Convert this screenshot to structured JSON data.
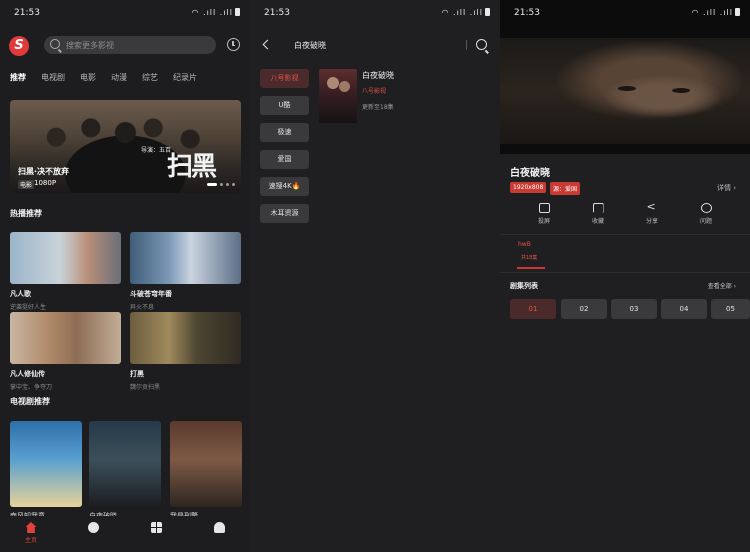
{
  "status": {
    "time": "21:53",
    "icons": "WiFi 5G 5G"
  },
  "home": {
    "logo": "S",
    "search_placeholder": "搜索更多影视",
    "categories": [
      "推荐",
      "电视剧",
      "电影",
      "动漫",
      "综艺",
      "纪录片"
    ],
    "banner": {
      "title": "扫黑·决不放弃",
      "badge": "电影",
      "resolution": "1080P",
      "director": "导演：五百",
      "big_title": "扫黑"
    },
    "hot_title": "热播推荐",
    "hot": [
      {
        "title": "凡人歌",
        "sub": "逆袭挺好人生"
      },
      {
        "title": "斗破苍穹年番",
        "sub": "异火不息"
      },
      {
        "title": "凡人修仙传",
        "sub": "掌中宝、争夺刀"
      },
      {
        "title": "打黑",
        "sub": "魏尔贡扫黑"
      }
    ],
    "tv_title": "电视剧推荐",
    "tv": [
      "南风知我意",
      "白夜破晓",
      "我是刑警"
    ],
    "nav": [
      {
        "label": "主页"
      }
    ]
  },
  "search": {
    "query": "白夜破晓",
    "sources": [
      "八号影视",
      "U酷",
      "极速",
      "爱国",
      "速搜4K🔥",
      "木耳资源"
    ],
    "result": {
      "title": "白夜破晓",
      "source": "八号影视",
      "update": "更新至18集"
    }
  },
  "detail": {
    "title": "白夜破晓",
    "tags": [
      "1920x808",
      "源：爱国"
    ],
    "detail_link": "详情 ›",
    "actions": [
      "投屏",
      "收藏",
      "分享",
      "问题"
    ],
    "source": "hwB",
    "source_sub": "共18集",
    "episodes_title": "剧集列表",
    "view_all": "查看全部 ›",
    "episodes": [
      "01",
      "02",
      "03",
      "04",
      "05"
    ]
  }
}
